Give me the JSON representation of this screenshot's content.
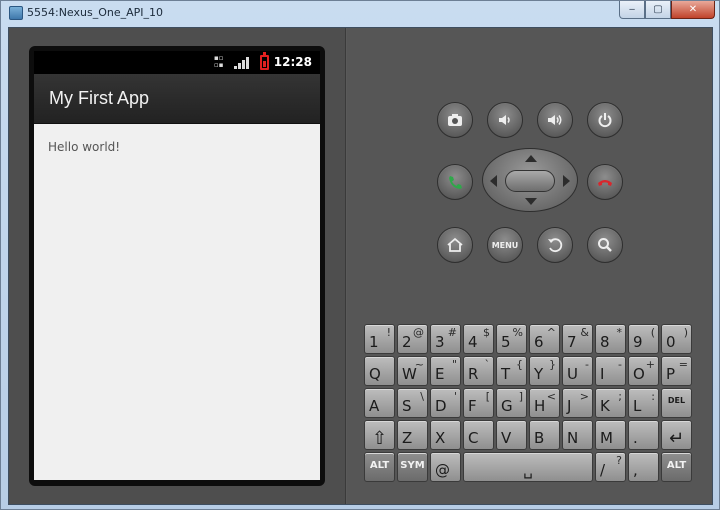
{
  "window": {
    "title": "5554:Nexus_One_API_10",
    "minimize": "‒",
    "maximize": "▢",
    "close": "✕"
  },
  "phone": {
    "status_time": "12:28",
    "app_title": "My First App",
    "hello_text": "Hello world!"
  },
  "controls": {
    "menu_label": "MENU"
  },
  "keyboard": {
    "rows": [
      [
        [
          "1",
          "!"
        ],
        [
          "2",
          "@"
        ],
        [
          "3",
          "#"
        ],
        [
          "4",
          "$"
        ],
        [
          "5",
          "%"
        ],
        [
          "6",
          "^"
        ],
        [
          "7",
          "&"
        ],
        [
          "8",
          "*"
        ],
        [
          "9",
          "("
        ],
        [
          "0",
          ")"
        ]
      ],
      [
        [
          "Q",
          ""
        ],
        [
          "W",
          "~"
        ],
        [
          "E",
          "\""
        ],
        [
          "R",
          "`"
        ],
        [
          "T",
          "{"
        ],
        [
          "Y",
          "}"
        ],
        [
          "U",
          "-"
        ],
        [
          "I",
          "-"
        ],
        [
          "O",
          "+"
        ],
        [
          "P",
          "="
        ]
      ],
      [
        [
          "A",
          ""
        ],
        [
          "S",
          "\\"
        ],
        [
          "D",
          "'"
        ],
        [
          "F",
          "["
        ],
        [
          "G",
          "]"
        ],
        [
          "H",
          "<"
        ],
        [
          "J",
          ">"
        ],
        [
          "K",
          ";"
        ],
        [
          "L",
          ":"
        ],
        [
          "DEL",
          ""
        ]
      ],
      [
        [
          "⇧",
          ""
        ],
        [
          "Z",
          ""
        ],
        [
          "X",
          ""
        ],
        [
          "C",
          ""
        ],
        [
          "V",
          ""
        ],
        [
          "B",
          ""
        ],
        [
          "N",
          ""
        ],
        [
          "M",
          ""
        ],
        [
          ".",
          ""
        ],
        [
          "↵",
          ""
        ]
      ]
    ],
    "bottom": {
      "alt_left": "ALT",
      "sym": "SYM",
      "at": "@",
      "space": "␣",
      "slash": "/",
      "slash_alt": "?",
      "comma": ",",
      "alt_right": "ALT"
    }
  }
}
